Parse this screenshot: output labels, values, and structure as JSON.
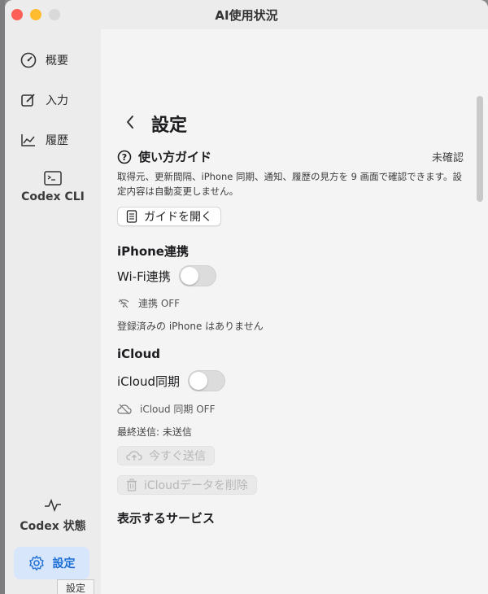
{
  "window": {
    "title": "AI使用状況"
  },
  "sidebar": {
    "items": [
      {
        "label": "概要",
        "icon": "gauge-icon"
      },
      {
        "label": "入力",
        "icon": "edit-icon"
      },
      {
        "label": "履歴",
        "icon": "line-chart-icon"
      },
      {
        "label": "Codex CLI",
        "icon": "terminal-icon"
      },
      {
        "label": "Codex 状態",
        "icon": "pulse-icon"
      },
      {
        "label": "設定",
        "icon": "gear-icon"
      }
    ],
    "tooltip": "設定"
  },
  "page": {
    "title": "設定",
    "guide": {
      "title": "使い方ガイド",
      "status": "未確認",
      "description": "取得元、更新間隔、iPhone 同期、通知、履歴の見方を 9 画面で確認できます。設定内容は自動変更しません。",
      "button_label": "ガイドを開く"
    },
    "iphone": {
      "section_title": "iPhone連携",
      "toggle_label": "Wi-Fi連携",
      "toggle_on": false,
      "status": "連携 OFF",
      "note": "登録済みの iPhone はありません"
    },
    "icloud": {
      "section_title": "iCloud",
      "toggle_label": "iCloud同期",
      "toggle_on": false,
      "status": "iCloud 同期 OFF",
      "last_sent": "最終送信: 未送信",
      "send_button": "今すぐ送信",
      "delete_button": "iCloudデータを削除"
    },
    "services": {
      "section_title": "表示するサービス"
    }
  },
  "colors": {
    "accent": "#1c6fd6",
    "selected_bg": "#d7e6fb",
    "close": "#fe5f57",
    "minimize": "#febc2e"
  }
}
